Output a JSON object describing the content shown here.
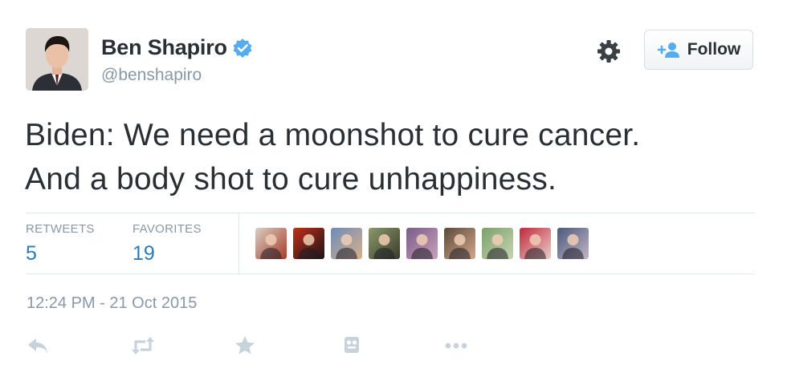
{
  "author": {
    "name": "Ben Shapiro",
    "handle": "@benshapiro",
    "verified": true,
    "avatar_icon": "profile-photo"
  },
  "header": {
    "follow_label": "Follow",
    "gear_icon": "gear-icon",
    "follow_icon": "add-user-icon"
  },
  "tweet": {
    "lines": [
      "Biden: We need a moonshot to cure cancer.",
      "And a body shot to cure unhappiness."
    ]
  },
  "stats": {
    "retweets_label": "RETWEETS",
    "retweets_count": "5",
    "favorites_label": "FAVORITES",
    "favorites_count": "19"
  },
  "favoriters": [
    {
      "name": "favoriter-avatar-1",
      "colors": [
        "#d8cfc4",
        "#a63d2a"
      ]
    },
    {
      "name": "favoriter-avatar-2",
      "colors": [
        "#c0301c",
        "#1c1414"
      ]
    },
    {
      "name": "favoriter-avatar-3",
      "colors": [
        "#6b8cb8",
        "#d9b08c"
      ]
    },
    {
      "name": "favoriter-avatar-4",
      "colors": [
        "#8a9a6a",
        "#3a3a2a"
      ]
    },
    {
      "name": "favoriter-avatar-5",
      "colors": [
        "#7a5c8a",
        "#c9a0b8"
      ]
    },
    {
      "name": "favoriter-avatar-6",
      "colors": [
        "#5a4a3a",
        "#d4a88a"
      ]
    },
    {
      "name": "favoriter-avatar-7",
      "colors": [
        "#7aa06a",
        "#c8d4b0"
      ]
    },
    {
      "name": "favoriter-avatar-8",
      "colors": [
        "#c0283c",
        "#e8d0c8"
      ]
    },
    {
      "name": "favoriter-avatar-9",
      "colors": [
        "#4a5a7a",
        "#c4b4c8"
      ]
    }
  ],
  "timestamp": "12:24 PM - 21 Oct 2015",
  "actions": [
    "reply-icon",
    "retweet-icon",
    "favorite-icon",
    "bookmark-icon",
    "more-icon"
  ],
  "colors": {
    "text": "#292f33",
    "muted": "#8899a6",
    "link": "#2b7bb9",
    "verified": "#55acee",
    "icon": "#c7d3dc"
  }
}
